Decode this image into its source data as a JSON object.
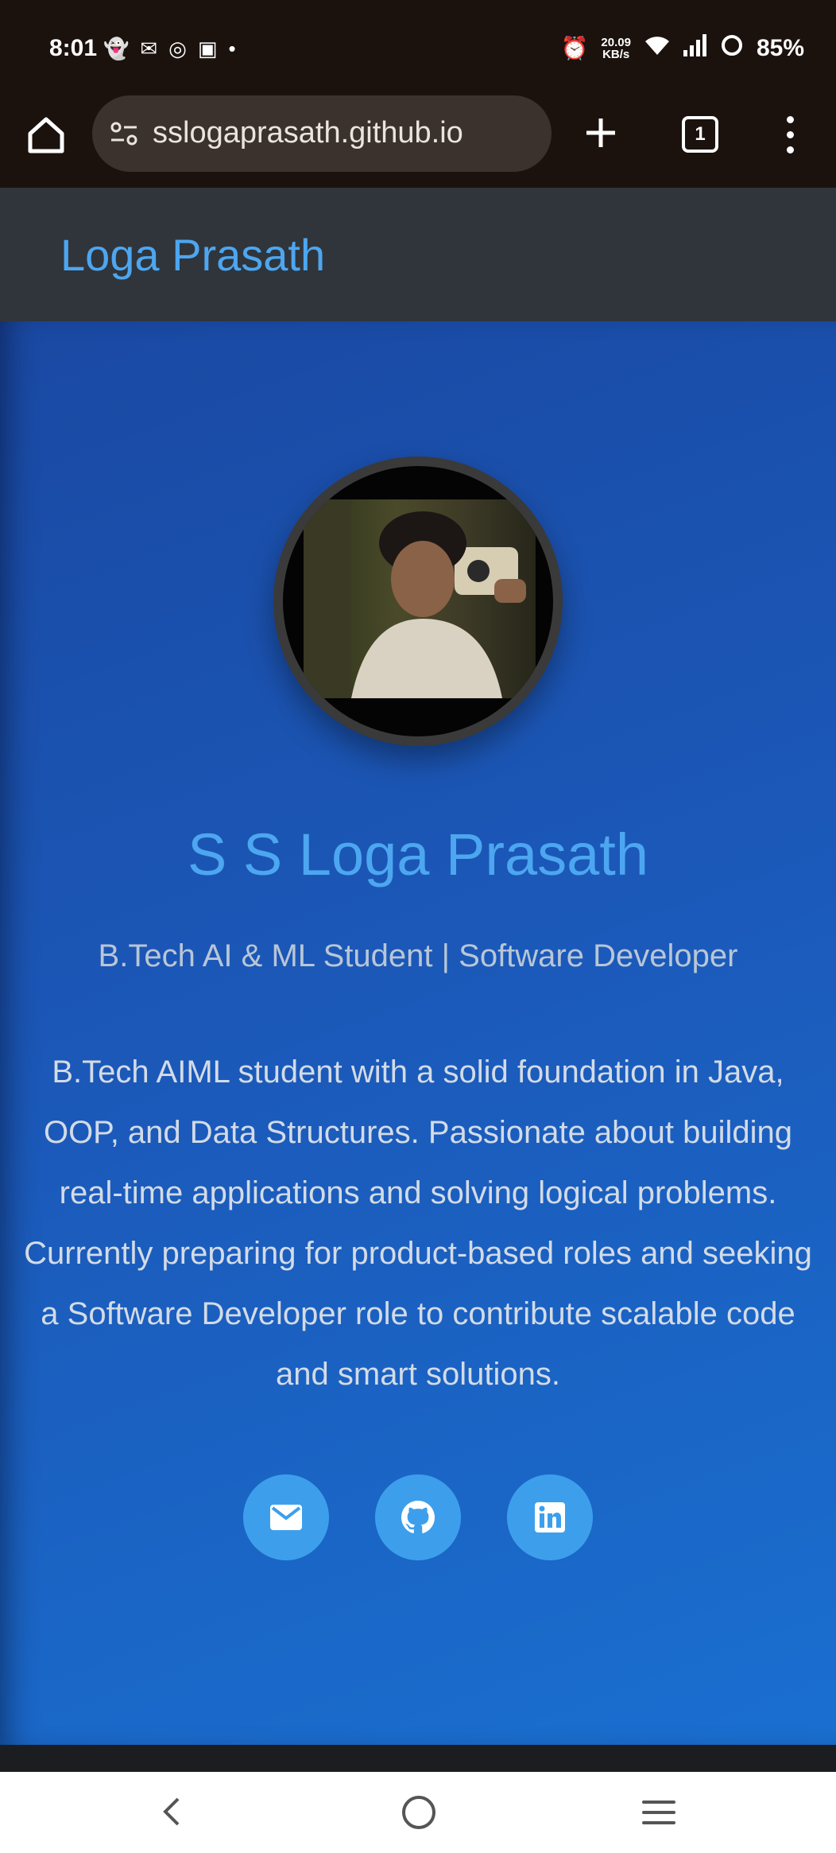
{
  "status_bar": {
    "time": "8:01",
    "left_icons": [
      "snapchat-icon",
      "gmail-icon",
      "instagram-icon",
      "app-icon",
      "dot-icon"
    ],
    "speed_top": "20.09",
    "speed_bottom": "KB/s",
    "battery": "85%"
  },
  "browser": {
    "url": "sslogaprasath.github.io",
    "tab_count": "1"
  },
  "nav": {
    "brand": "Loga Prasath"
  },
  "hero": {
    "name": "S S Loga Prasath",
    "subtitle": "B.Tech AI & ML Student | Software Developer",
    "bio": "B.Tech AIML student with a solid foundation in Java,\nOOP, and Data Structures. Passionate about building\nreal-time applications and solving logical problems.\nCurrently preparing for product-based roles and seeking\na Software Developer role to contribute scalable code\nand smart solutions.",
    "socials": [
      "email-icon",
      "github-icon",
      "linkedin-icon"
    ]
  },
  "colors": {
    "accent": "#4da6f0",
    "social_button": "#3d9fec",
    "navbar_bg": "#30353b"
  }
}
